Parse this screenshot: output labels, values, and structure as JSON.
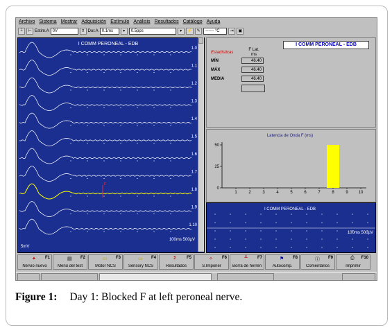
{
  "menu": [
    "Archivo",
    "Sistema",
    "Mostrar",
    "Adquisición",
    "Estímulo",
    "Análisis",
    "Resultados",
    "Catálogo",
    "Ayuda"
  ],
  "toolbar": {
    "estim_label": "Estim.A",
    "estim_value": "0V",
    "dur_label": "Dur.A",
    "dur_value": "0.1ms",
    "rate_value": "0.5pps",
    "temp_value": "------ °C"
  },
  "waveform_panel": {
    "title": "I COMM PERONEAL - EDB",
    "trace_labels": [
      "1.0",
      "1.1",
      "1.2",
      "1.3",
      "1.4",
      "1.5",
      "1.6",
      "1.7",
      "1.8",
      "1.9",
      "1.10"
    ],
    "scale_left": "5mV",
    "scale_right": "100ms 500µV",
    "marker": "F"
  },
  "stats_panel": {
    "title": "I COMM PERONEAL - EDB",
    "section_label": "Estadísticas",
    "column_header": "F Lat.",
    "column_unit": "ms",
    "rows": [
      {
        "label": "MÍN",
        "value": "46.40"
      },
      {
        "label": "MÁX",
        "value": "46.40"
      },
      {
        "label": "MEDIA",
        "value": "46.40"
      }
    ]
  },
  "chart_data": {
    "type": "bar",
    "title": "Latencia de Onda F (ms)",
    "categories": [
      "1",
      "2",
      "3",
      "4",
      "5",
      "6",
      "7",
      "8",
      "9",
      "10"
    ],
    "values": [
      0,
      0,
      0,
      0,
      0,
      0,
      0,
      50,
      0,
      0
    ],
    "ylim": [
      0,
      50
    ],
    "yticks": [
      "0",
      "25",
      "50"
    ],
    "bar_color": "#ffff00"
  },
  "mini_panel": {
    "title": "I COMM PERONEAL - EDB",
    "scale": "100ms 500µV"
  },
  "fkeys": [
    {
      "key": "F1",
      "label": "Nervio nuevo",
      "icon": "✦"
    },
    {
      "key": "F2",
      "label": "Menú del test",
      "icon": "▤"
    },
    {
      "key": "F3",
      "label": "Motor NCS",
      "icon": "▭"
    },
    {
      "key": "F4",
      "label": "Sensory NCS",
      "icon": "▭"
    },
    {
      "key": "F5",
      "label": "Resultados",
      "icon": "Σ"
    },
    {
      "key": "F6",
      "label": "S.Imponer",
      "icon": "✧"
    },
    {
      "key": "F7",
      "label": "Borra de herren",
      "icon": "╨"
    },
    {
      "key": "F8",
      "label": "Autocomp.",
      "icon": "⚑"
    },
    {
      "key": "F9",
      "label": "Comentarios",
      "icon": "ⓘ"
    },
    {
      "key": "F10",
      "label": "Imprimir",
      "icon": "⎙"
    }
  ],
  "caption": {
    "label": "Figure 1:",
    "text": "Day 1: Blocked F at left peroneal nerve."
  },
  "colors": {
    "panel_blue": "#1a2f8f",
    "trace": "#ffffff",
    "highlight_trace": "#ffff00",
    "marker": "#ff3030"
  }
}
